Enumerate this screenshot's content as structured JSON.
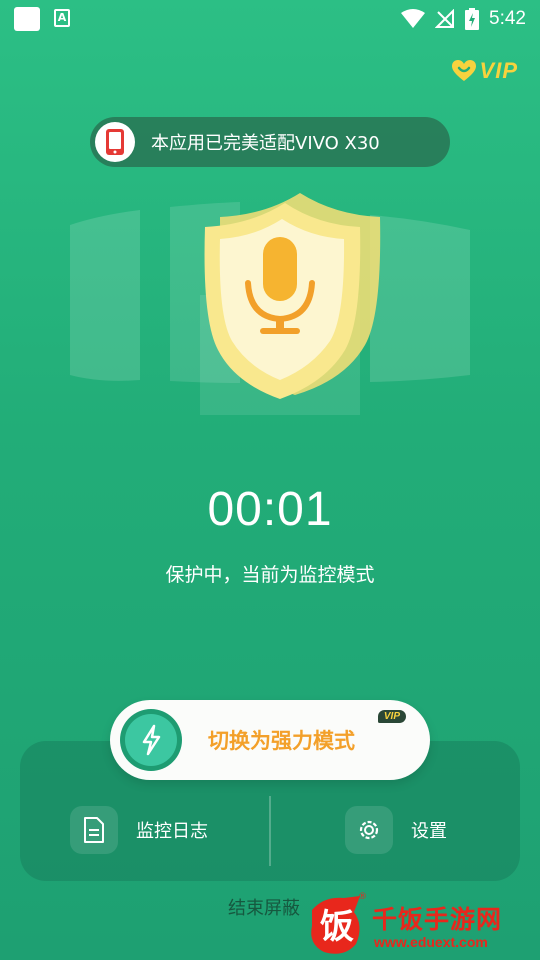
{
  "status_bar": {
    "time": "5:42",
    "notification_icon": "A"
  },
  "header": {
    "vip_label": "VIP"
  },
  "adapt_banner": {
    "text": "本应用已完美适配VIVO X30",
    "icon": "phone-icon"
  },
  "hero": {
    "icon": "microphone-shield-icon"
  },
  "timer": {
    "value": "00:01"
  },
  "status": {
    "text": "保护中，当前为监控模式"
  },
  "switch_button": {
    "label": "切换为强力模式",
    "vip_badge": "VIP",
    "icon": "lightning-icon"
  },
  "panel": {
    "log_label": "监控日志",
    "settings_label": "设置"
  },
  "end_button": {
    "label": "结束屏蔽"
  },
  "watermark": {
    "logo_char": "饭",
    "name": "千饭手游网",
    "url": "www.eduext.com",
    "reg": "®"
  },
  "colors": {
    "background": "#22ad78",
    "accent_orange": "#f3a02a",
    "vip_gold": "#f7d23e",
    "watermark_red": "#e8271c"
  }
}
